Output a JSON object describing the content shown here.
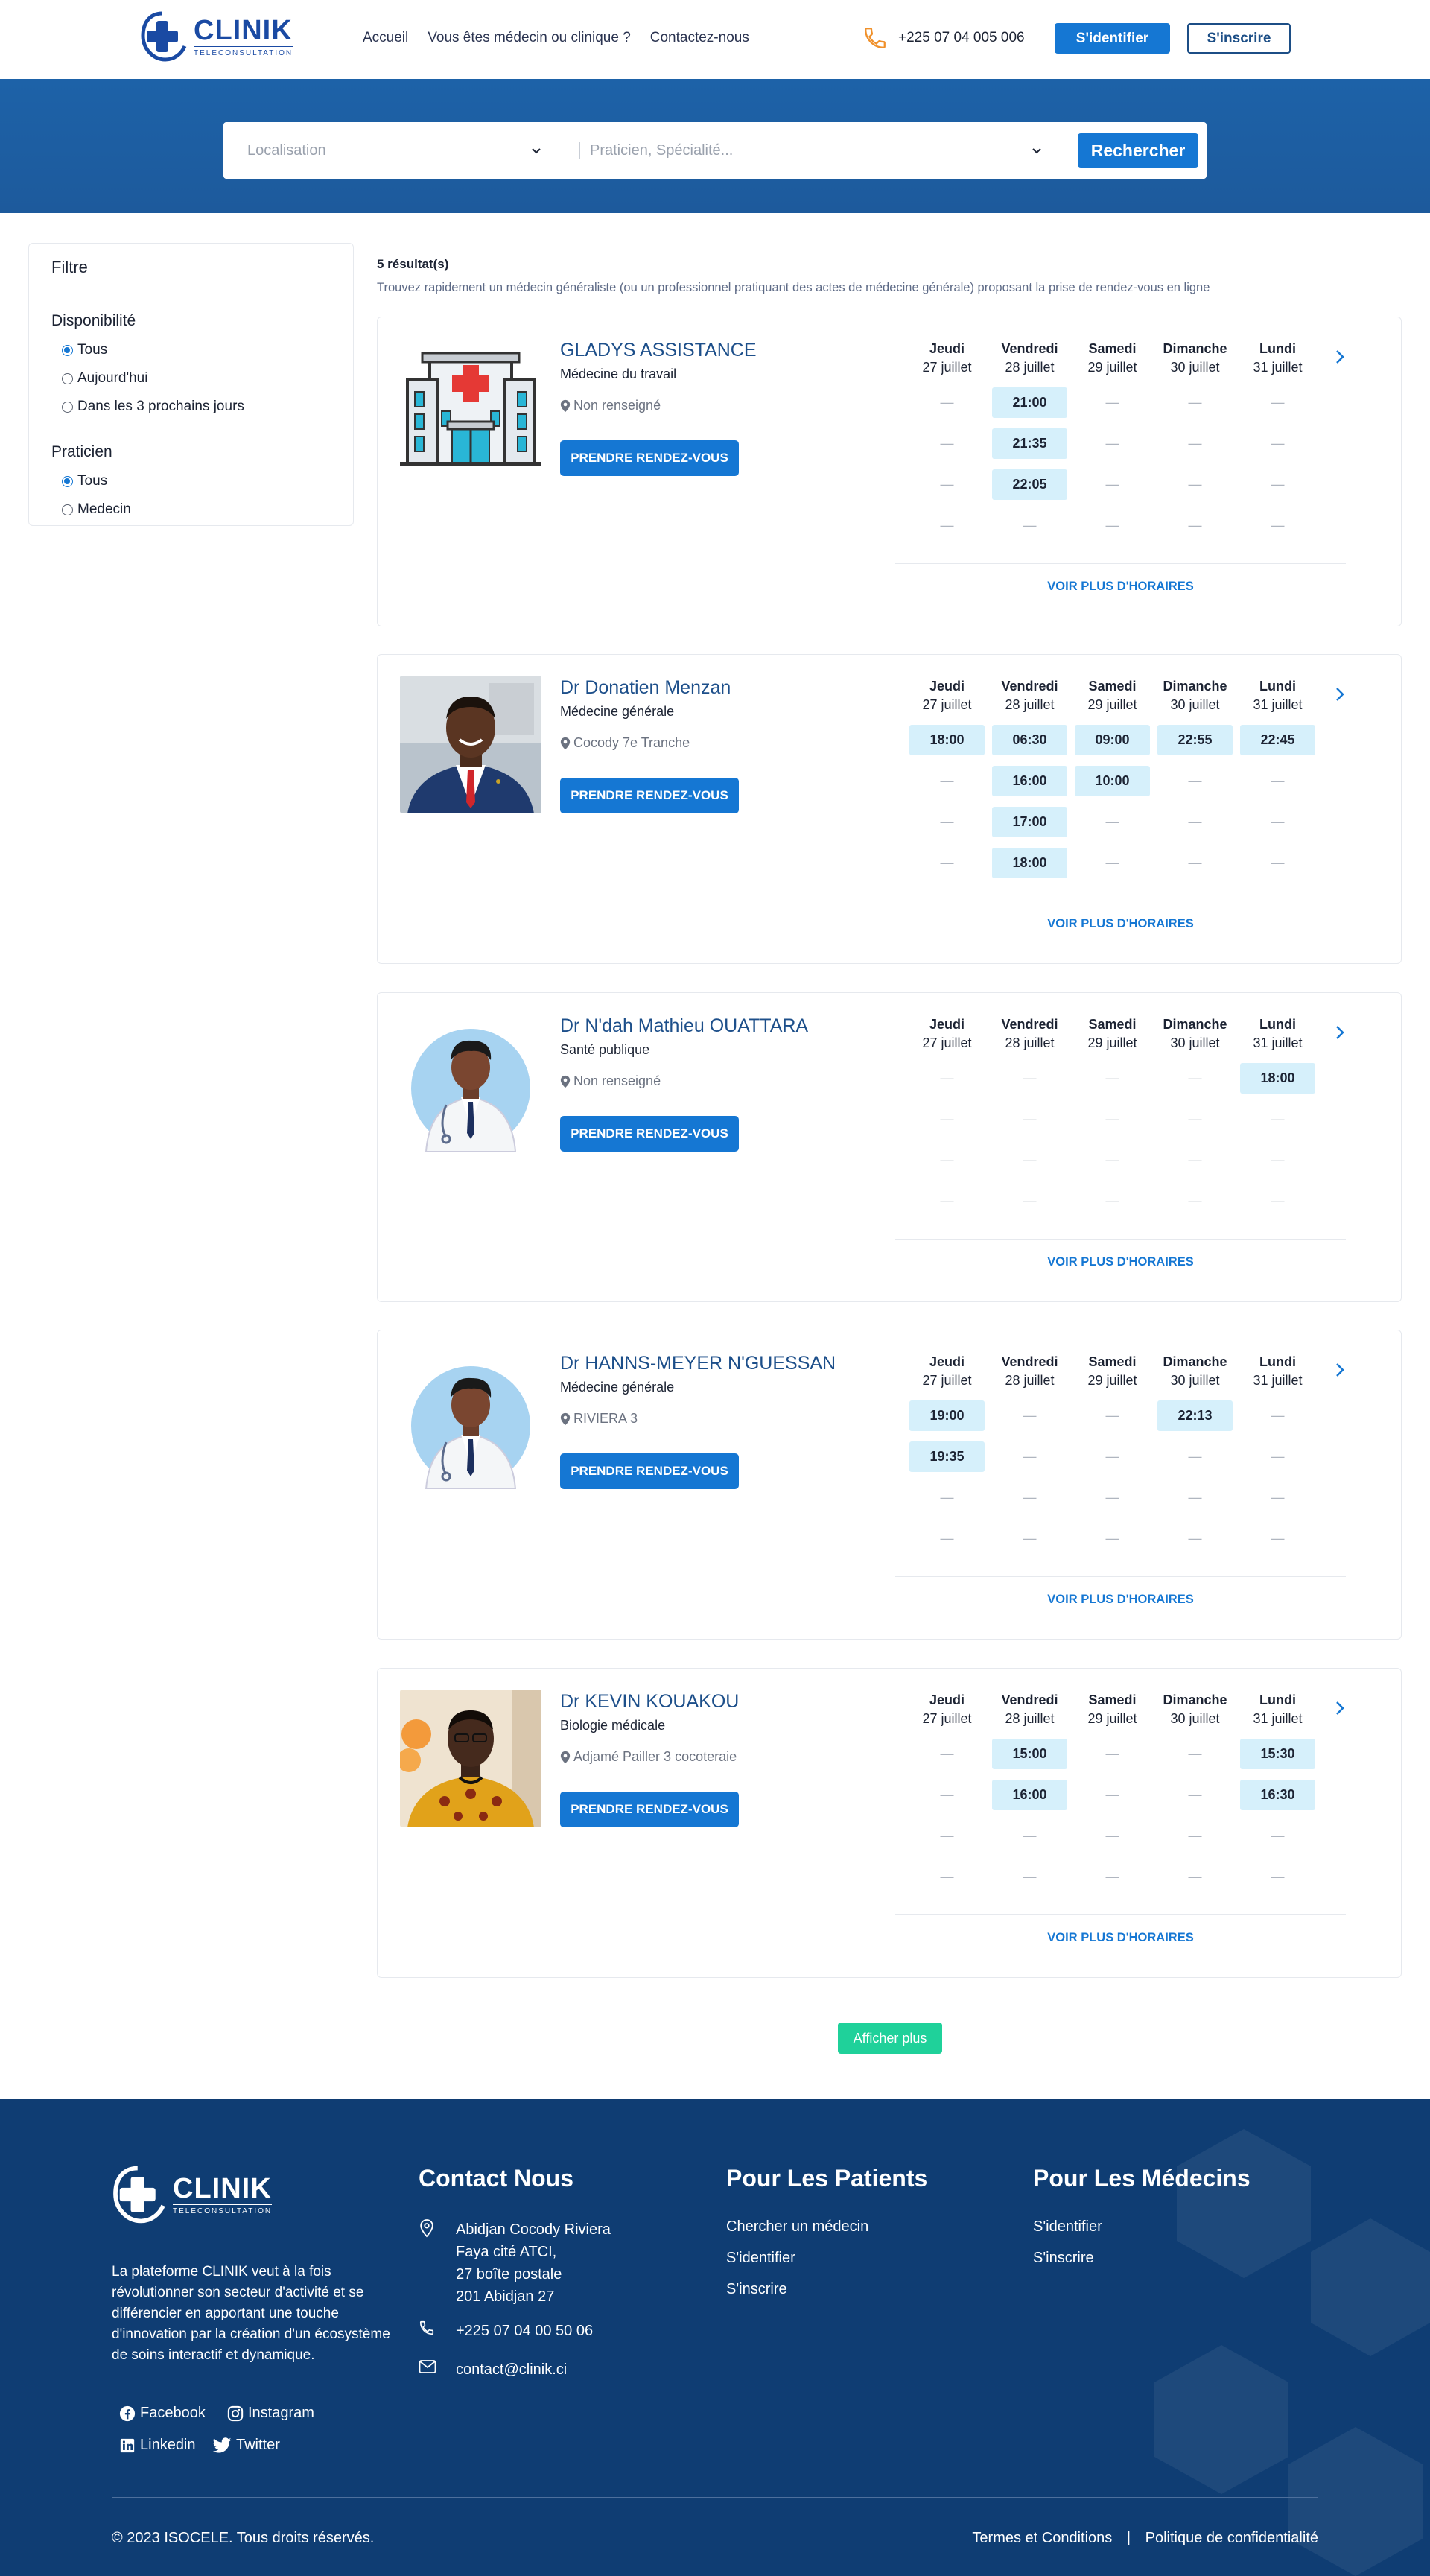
{
  "header": {
    "logo_name": "CLINIK",
    "logo_sub": "TELECONSULTATION",
    "nav": [
      "Accueil",
      "Vous êtes médecin ou clinique ?",
      "Contactez-nous"
    ],
    "phone": "+225 07 04 005 006",
    "login": "S'identifier",
    "signup": "S'inscrire"
  },
  "search": {
    "location_placeholder": "Localisation",
    "specialty_placeholder": "Praticien, Spécialité...",
    "button": "Rechercher"
  },
  "filter": {
    "title": "Filtre",
    "availability_title": "Disponibilité",
    "availability_options": [
      "Tous",
      "Aujourd'hui",
      "Dans les 3 prochains jours"
    ],
    "practitioner_title": "Praticien",
    "practitioner_options": [
      "Tous",
      "Medecin"
    ]
  },
  "results": {
    "count": "5 résultat(s)",
    "description": "Trouvez rapidement un médecin généraliste (ou un professionnel pratiquant des actes de médecine générale) proposant la prise de rendez-vous en ligne",
    "days": [
      {
        "name": "Jeudi",
        "date": "27 juillet"
      },
      {
        "name": "Vendredi",
        "date": "28 juillet"
      },
      {
        "name": "Samedi",
        "date": "29 juillet"
      },
      {
        "name": "Dimanche",
        "date": "30 juillet"
      },
      {
        "name": "Lundi",
        "date": "31 juillet"
      }
    ],
    "rdv_label": "PRENDRE RENDEZ-VOUS",
    "more_hours_label": "VOIR PLUS D'HORAIRES",
    "empty_slot": "—",
    "doctors": [
      {
        "name": "GLADYS ASSISTANCE",
        "specialty": "Médecine du travail",
        "address": "Non renseigné",
        "avatar": "hospital-illustration",
        "slots": [
          [
            "",
            "",
            "",
            ""
          ],
          [
            "21:00",
            "21:35",
            "22:05",
            ""
          ],
          [
            "",
            "",
            "",
            ""
          ],
          [
            "",
            "",
            "",
            ""
          ],
          [
            "",
            "",
            "",
            ""
          ]
        ]
      },
      {
        "name": "Dr Donatien Menzan",
        "specialty": "Médecine générale",
        "address": "Cocody 7e Tranche",
        "avatar": "photo-man-suit",
        "slots": [
          [
            "18:00",
            "",
            "",
            ""
          ],
          [
            "06:30",
            "16:00",
            "17:00",
            "18:00"
          ],
          [
            "09:00",
            "10:00",
            "",
            ""
          ],
          [
            "22:55",
            "",
            "",
            ""
          ],
          [
            "22:45",
            "",
            "",
            ""
          ]
        ]
      },
      {
        "name": "Dr N'dah Mathieu OUATTARA",
        "specialty": "Santé publique",
        "address": "Non renseigné",
        "avatar": "doctor-illustration",
        "slots": [
          [
            "",
            "",
            "",
            ""
          ],
          [
            "",
            "",
            "",
            ""
          ],
          [
            "",
            "",
            "",
            ""
          ],
          [
            "",
            "",
            "",
            ""
          ],
          [
            "18:00",
            "",
            "",
            ""
          ]
        ]
      },
      {
        "name": "Dr HANNS-MEYER N'GUESSAN",
        "specialty": "Médecine générale",
        "address": "RIVIERA 3",
        "avatar": "doctor-illustration",
        "slots": [
          [
            "19:00",
            "19:35",
            "",
            ""
          ],
          [
            "",
            "",
            "",
            ""
          ],
          [
            "",
            "",
            "",
            ""
          ],
          [
            "22:13",
            "",
            "",
            ""
          ],
          [
            "",
            "",
            "",
            ""
          ]
        ]
      },
      {
        "name": "Dr KEVIN KOUAKOU",
        "specialty": "Biologie médicale",
        "address": "Adjamé Pailler 3 cocoteraie",
        "avatar": "photo-man-traditional",
        "slots": [
          [
            "",
            "",
            "",
            ""
          ],
          [
            "15:00",
            "16:00",
            "",
            ""
          ],
          [
            "",
            "",
            "",
            ""
          ],
          [
            "",
            "",
            "",
            ""
          ],
          [
            "15:30",
            "16:30",
            "",
            ""
          ]
        ]
      }
    ],
    "show_more": "Afficher plus"
  },
  "footer": {
    "logo_name": "CLINIK",
    "logo_sub": "TELECONSULTATION",
    "about": "La plateforme CLINIK veut à la fois révolutionner son secteur d'activité et se différencier en apportant une touche d'innovation par la création d'un écosystème de soins interactif et dynamique.",
    "social": [
      "Facebook",
      "Instagram",
      "Linkedin",
      "Twitter"
    ],
    "contact_title": "Contact Nous",
    "address_lines": [
      "Abidjan Cocody Riviera",
      "Faya cité ATCI,",
      "27 boîte postale",
      "201 Abidjan 27"
    ],
    "phone": "+225 07 04 00 50 06",
    "email": "contact@clinik.ci",
    "patients_title": "Pour Les Patients",
    "patients_links": [
      "Chercher un médecin",
      "S'identifier",
      "S'inscrire"
    ],
    "doctors_title": "Pour Les Médecins",
    "doctors_links": [
      "S'identifier",
      "S'inscrire"
    ],
    "copyright": "© 2023 ISOCELE. Tous droits réservés.",
    "terms": "Termes et Conditions",
    "privacy": "Politique de confidentialité",
    "legal_separator": "|"
  },
  "colors": {
    "primary": "#1577d3",
    "navy": "#0f3d73",
    "slot": "#d6f0fb",
    "accent": "#1fd19a",
    "phone_icon": "#f0902a"
  }
}
